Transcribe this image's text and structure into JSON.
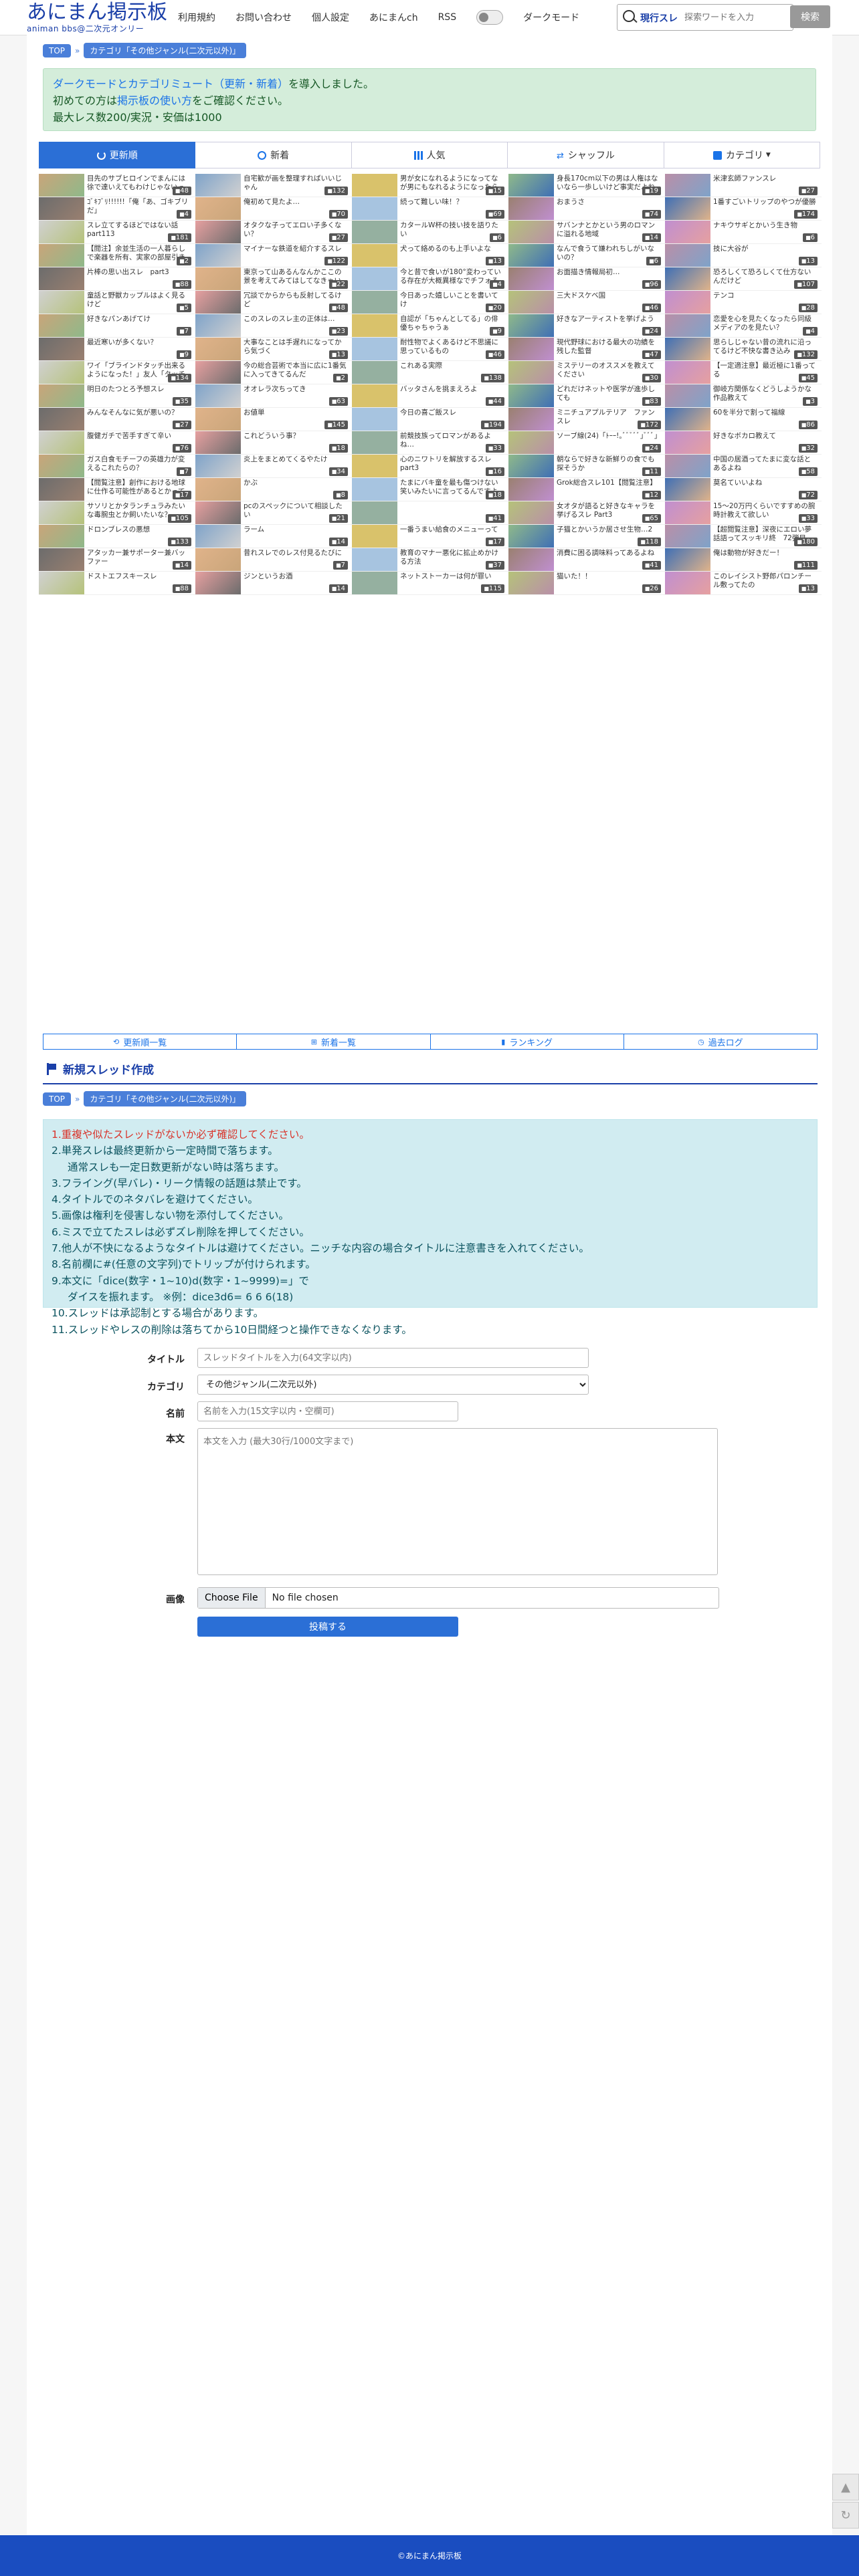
{
  "header": {
    "logo_main": "あにまん掲示板",
    "logo_sub": "animan bbs@二次元オンリー",
    "nav": [
      "利用規約",
      "お問い合わせ",
      "個人設定",
      "あにまんch",
      "RSS"
    ],
    "dark_mode_label": "ダークモード",
    "hot_label": "現行スレ",
    "search_placeholder": "探索ワードを入力",
    "search_button": "検索"
  },
  "breadcrumb": {
    "top": "TOP",
    "sep": "»",
    "category": "カテゴリ「その他ジャンル(二次元以外)」"
  },
  "notice": {
    "line1_pre": "ダークモードとカテゴリミュート（更新・新着）",
    "line1_post": "を導入しました。",
    "line2_pre": "初めての方は",
    "line2_link": "掲示板の使い方",
    "line2_post": "をご確認ください。",
    "line3": "最大レス数200/実況・安価は1000"
  },
  "tabs": [
    "更新順",
    "新着",
    "人気",
    "シャッフル",
    "カテゴリ"
  ],
  "threads": [
    {
      "t": "目先のサブヒロインでまんには徐で達いえてもわけじゃないって踏台付けで先に立ってるよな",
      "c": "48"
    },
    {
      "t": "自宅歓が画を整理すればいいじゃん",
      "c": "132"
    },
    {
      "t": "男が女になれるようになってなが男にもなれるようになったら",
      "c": "15"
    },
    {
      "t": "身長170cm以下の男は人権はないなら一歩しいけど事実だよね",
      "c": "19"
    },
    {
      "t": "米津玄師ファンスレ",
      "c": "27"
    },
    {
      "t": "ｺﾞｷﾌﾞﾘ!!!!!!「俺「あ、ゴキブリだ」",
      "c": "4"
    },
    {
      "t": "俺初めて見たよ…",
      "c": "70"
    },
    {
      "t": "続って難しい味！？",
      "c": "69"
    },
    {
      "t": "おまうさ",
      "c": "74"
    },
    {
      "t": "1番すごいトリップのやつが優勝",
      "c": "174"
    },
    {
      "t": "スレ立てするほどではない話part113",
      "c": "181"
    },
    {
      "t": "オタクな子ってエロい子多くない？",
      "c": "27"
    },
    {
      "t": "カタールW杯の技い技を語りたい",
      "c": "6"
    },
    {
      "t": "サバンナとかという男のロマンに溢れる地域",
      "c": "14"
    },
    {
      "t": "ナキウサギとかいう生き物",
      "c": "6"
    },
    {
      "t": "【閲注】余並生活の一人暮らしで楽器を所有、実家の部屋引き渡しとしたいスレ",
      "c": "2"
    },
    {
      "t": "マイナーな鉄道を紹介するスレ",
      "c": "122"
    },
    {
      "t": "犬って絡めるのも上手いよな",
      "c": "13"
    },
    {
      "t": "なんで食うて嫌われちしがいないの？",
      "c": "6"
    },
    {
      "t": "技に大谷が",
      "c": "13"
    },
    {
      "t": "片棒の思い出スレ　part3",
      "c": "88"
    },
    {
      "t": "東京って山あるんなんかここの景を考えてみてはしてなきゃいけないの",
      "c": "22"
    },
    {
      "t": "今と昔で食いが180°変わっている存在が大概異様なでチフォろあるよね",
      "c": "4"
    },
    {
      "t": "お面描き情報局初…",
      "c": "96"
    },
    {
      "t": "恐ろしくて恐ろしくて仕方ないんだけど",
      "c": "107"
    },
    {
      "t": "童話と野獣カップルはよく見るけど",
      "c": "5"
    },
    {
      "t": "冗談でからからも反射してるけど",
      "c": "48"
    },
    {
      "t": "今日あった嬉しいことを書いてけ",
      "c": "20"
    },
    {
      "t": "三大ドスケベ国",
      "c": "46"
    },
    {
      "t": "テンコ",
      "c": "28"
    },
    {
      "t": "好きなパンあげてけ",
      "c": "7"
    },
    {
      "t": "このスレのスレ主の正体は…",
      "c": "23"
    },
    {
      "t": "自認が「ちゃんとしてる」の俳優ちゃちゃうぁ",
      "c": "9"
    },
    {
      "t": "好きなアーティストを挙げよう",
      "c": "24"
    },
    {
      "t": "恋愛を心を見たくなったら同級メディアのを見たい？",
      "c": "4"
    },
    {
      "t": "最近寒いが多くない？",
      "c": "9"
    },
    {
      "t": "大事なことは手遅れになってから気づく",
      "c": "13"
    },
    {
      "t": "耐性物でよくあるけど不思議に思っているもの",
      "c": "46"
    },
    {
      "t": "現代野球における最大の功績を残した監督",
      "c": "47"
    },
    {
      "t": "思らしじゃない昔の流れに沿ってるけど不快な書き込み",
      "c": "132"
    },
    {
      "t": "ワイ「ブラインドタッチ出来るようになった！」友人「タッチタイピング、な？」",
      "c": "134"
    },
    {
      "t": "今の総合芸術で本当に広に1番気に入ってきてるんだ",
      "c": "2"
    },
    {
      "t": "これある実際",
      "c": "138"
    },
    {
      "t": "ミステリーのオススメを教えてください",
      "c": "30"
    },
    {
      "t": "【一定適注意】最近極に1番ってる",
      "c": "45"
    },
    {
      "t": "明日のたつとろ予想スレ",
      "c": "35"
    },
    {
      "t": "オオレラ次ちってき",
      "c": "63"
    },
    {
      "t": "バッタさんを挑まえろよ",
      "c": "44"
    },
    {
      "t": "どれだけネットや医学が進歩しても",
      "c": "83"
    },
    {
      "t": "御岐方関係なくどうしようかな作品教えて",
      "c": "3"
    },
    {
      "t": "みんなそんなに気が悪いの？",
      "c": "27"
    },
    {
      "t": "お値単",
      "c": "145"
    },
    {
      "t": "今日の喜ご飯スレ",
      "c": "194"
    },
    {
      "t": "ミニチュアプルテリア　ファンスレ",
      "c": "172"
    },
    {
      "t": "60を半分で割って福線",
      "c": "86"
    },
    {
      "t": "腹健ガチで苦手すぎて辛い",
      "c": "76"
    },
    {
      "t": "これどういう事？",
      "c": "18"
    },
    {
      "t": "前競技族ってロマンがあるよね…",
      "c": "33"
    },
    {
      "t": "ソーブ線(24)「ﾄｰｰ!｡ﾞﾞﾞﾞﾞ｣ﾞﾞﾞ」",
      "c": "24"
    },
    {
      "t": "好きなボカロ教えて",
      "c": "32"
    },
    {
      "t": "ガス白食モチーフの英雄力が変えるこれたらの？",
      "c": "7"
    },
    {
      "t": "炎上をまとめてくるやたけ",
      "c": "34"
    },
    {
      "t": "心のニワトリを解放するスレpart3",
      "c": "16"
    },
    {
      "t": "朝ならで好きな新鮮りの食でも探そうか",
      "c": "11"
    },
    {
      "t": "中国の居酒ってたまに変な話とあるよね",
      "c": "58"
    },
    {
      "t": "【閲覧注意】創作における地球に仕作る可能性があるとかってる",
      "c": "17"
    },
    {
      "t": "かぶ",
      "c": "8"
    },
    {
      "t": "たまにバキ童を最も傷つけない笑いみたいに言ってるんですよ",
      "c": "18"
    },
    {
      "t": "Grok総合スレ101【閲覧注意】",
      "c": "12"
    },
    {
      "t": "莫名ていいよね",
      "c": "72"
    },
    {
      "t": "サソリとかタランチュラみたいな毒腕虫とか飼いたいな？",
      "c": "105"
    },
    {
      "t": "pcのスペックについて相談したい",
      "c": "21"
    },
    {
      "t": "",
      "c": "41"
    },
    {
      "t": "女オタが語ると好きなキャラを挙げるスレ Part3",
      "c": "65"
    },
    {
      "t": "15～20万円くらいですすめの腕時計教えて欲しい",
      "c": "33"
    },
    {
      "t": "ドロンブレスの悪想",
      "c": "133"
    },
    {
      "t": "ラーム",
      "c": "14"
    },
    {
      "t": "一番うまい給食のメニューって",
      "c": "17"
    },
    {
      "t": "子猫とかいうか居させ生物…2",
      "c": "118"
    },
    {
      "t": "【超閲覧注意】深夜にエロい夢話語ってスッキリ終　72弾目",
      "c": "180"
    },
    {
      "t": "アタッカー兼サポーター兼バッファー",
      "c": "14"
    },
    {
      "t": "昔れスレでのレス付見るたびに",
      "c": "7"
    },
    {
      "t": "教育のマナー悪化に拡止めかける方法",
      "c": "37"
    },
    {
      "t": "消費に困る調味料ってあるよね",
      "c": "41"
    },
    {
      "t": "俺は動物が好きだー！",
      "c": "111"
    },
    {
      "t": "ドストエフスキースレ",
      "c": "88"
    },
    {
      "t": "ジンというお酒",
      "c": "14"
    },
    {
      "t": "ネットストーカーは何が罪い",
      "c": "115"
    },
    {
      "t": "猫いた！！",
      "c": "26"
    },
    {
      "t": "このレイシスト野郎パロンチール敷ってたの",
      "c": "13"
    }
  ],
  "thumb_colors": [
    "#c9a57a",
    "#7fa3c9",
    "#d9c26b",
    "#8fb98a",
    "#b98fa8",
    "#6c6c6c",
    "#e0b38a",
    "#a7c4e0",
    "#9a8070",
    "#3f6fb5",
    "#d1d1d1",
    "#e6a0a0",
    "#95b0a0",
    "#b5c27a",
    "#c08fd0"
  ],
  "bottom_links": [
    "更新順一覧",
    "新着一覧",
    "ランキング",
    "過去ログ"
  ],
  "new_thread": {
    "heading": "新規スレッド作成",
    "rules": [
      "1.重複や似たスレッドがないか必ず確認してください。",
      "2.単発スレは最終更新から一定時間で落ちます。",
      "通常スレも一定日数更新がない時は落ちます。",
      "3.フライング(早バレ)・リーク情報の話題は禁止です。",
      "4.タイトルでのネタバレを避けてください。",
      "5.画像は権利を侵害しない物を添付してください。",
      "6.ミスで立てたスレは必ずズレ削除を押してください。",
      "7.他人が不快になるようなタイトルは避けてください。ニッチな内容の場合タイトルに注意書きを入れてください。",
      "8.名前欄に#(任意の文字列)でトリップが付けられます。",
      "9.本文に「dice(数字・1~10)d(数字・1~9999)=」で",
      "ダイスを振れます。 ※例：dice3d6= 6 6 6(18)",
      "10.スレッドは承認制とする場合があります。",
      "11.スレッドやレスの削除は落ちてから10日間経つと操作できなくなります。"
    ],
    "title_label": "タイトル",
    "title_placeholder": "スレッドタイトルを入力(64文字以内)",
    "category_label": "カテゴリ",
    "category_value": "その他ジャンル(二次元以外)",
    "name_label": "名前",
    "name_placeholder": "名前を入力(15文字以内・空欄可)",
    "body_label": "本文",
    "body_placeholder": "本文を入力 (最大30行/1000文字まで)",
    "image_label": "画像",
    "file_button": "Choose File",
    "file_status": "No file chosen",
    "submit": "投稿する"
  },
  "footer": "©あにまん掲示板"
}
